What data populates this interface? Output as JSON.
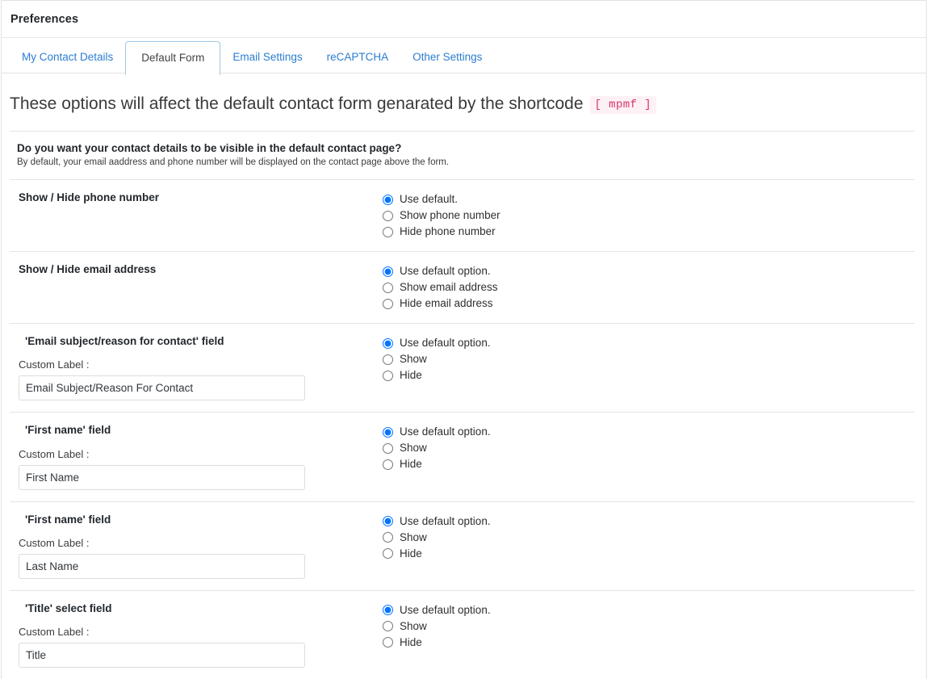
{
  "panel": {
    "title": "Preferences"
  },
  "tabs": [
    {
      "label": "My Contact Details",
      "active": false
    },
    {
      "label": "Default Form",
      "active": true
    },
    {
      "label": "Email Settings",
      "active": false
    },
    {
      "label": "reCAPTCHA",
      "active": false
    },
    {
      "label": "Other Settings",
      "active": false
    }
  ],
  "main": {
    "heading": "These options will affect the default contact form genarated by the shortcode",
    "shortcode": "[ mpmf ]",
    "intro": {
      "title": "Do you want your contact details to be visible in the default contact page?",
      "subtitle": "By default, your email aaddress and phone number will be displayed on the contact page above the form."
    },
    "custom_label_text": "Custom Label :",
    "sections": [
      {
        "title": "Show / Hide phone number",
        "has_input": false,
        "options": [
          {
            "label": "Use default.",
            "selected": true
          },
          {
            "label": "Show phone number",
            "selected": false
          },
          {
            "label": "Hide phone number",
            "selected": false
          }
        ]
      },
      {
        "title": "Show / Hide email address",
        "has_input": false,
        "options": [
          {
            "label": "Use default option.",
            "selected": true
          },
          {
            "label": "Show email address",
            "selected": false
          },
          {
            "label": "Hide email address",
            "selected": false
          }
        ]
      },
      {
        "title": "'Email subject/reason for contact' field",
        "has_input": true,
        "input_value": "Email Subject/Reason For Contact",
        "options": [
          {
            "label": "Use default option.",
            "selected": true
          },
          {
            "label": "Show",
            "selected": false
          },
          {
            "label": "Hide",
            "selected": false
          }
        ]
      },
      {
        "title": "'First name' field",
        "has_input": true,
        "input_value": "First Name",
        "options": [
          {
            "label": "Use default option.",
            "selected": true
          },
          {
            "label": "Show",
            "selected": false
          },
          {
            "label": "Hide",
            "selected": false
          }
        ]
      },
      {
        "title": "'First name' field",
        "has_input": true,
        "input_value": "Last Name",
        "options": [
          {
            "label": "Use default option.",
            "selected": true
          },
          {
            "label": "Show",
            "selected": false
          },
          {
            "label": "Hide",
            "selected": false
          }
        ]
      },
      {
        "title": "'Title' select field",
        "has_input": true,
        "input_value": "Title",
        "options": [
          {
            "label": "Use default option.",
            "selected": true
          },
          {
            "label": "Show",
            "selected": false
          },
          {
            "label": "Hide",
            "selected": false
          }
        ]
      }
    ]
  },
  "colors": {
    "link": "#2b7dd0",
    "active_tab_border": "#9cc9ea",
    "shortcode_text": "#d6336c",
    "shortcode_bg": "#fdf1f5"
  }
}
